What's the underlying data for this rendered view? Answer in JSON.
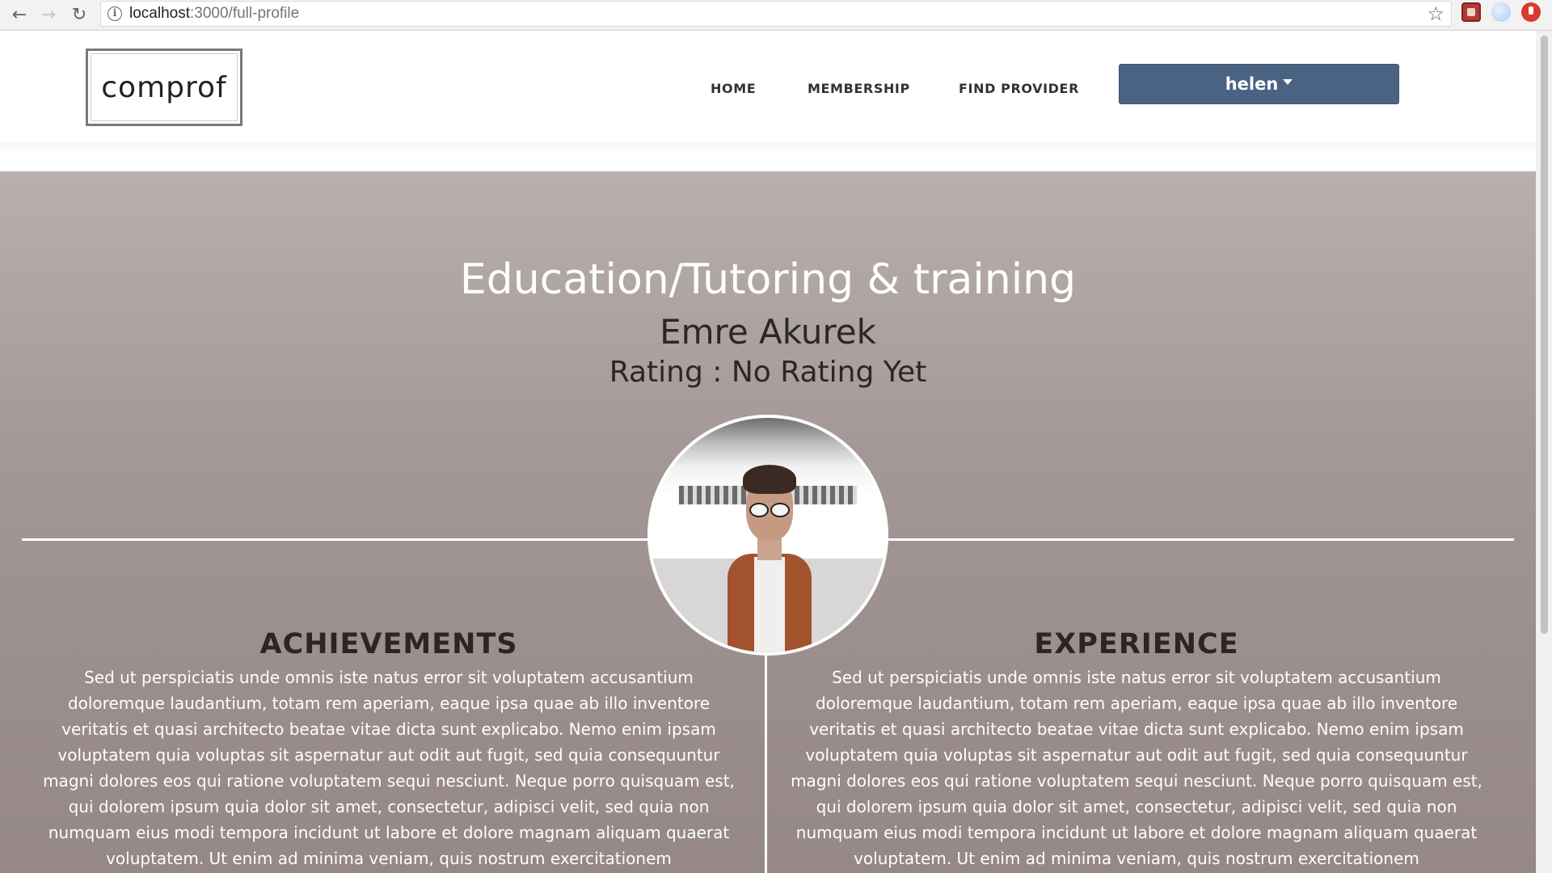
{
  "browser": {
    "url_host": "localhost",
    "url_path": ":3000/full-profile",
    "back_icon": "←",
    "forward_icon": "→",
    "reload_icon": "↻",
    "star_icon": "☆"
  },
  "header": {
    "logo": "comprof",
    "nav": {
      "home": "HOME",
      "membership": "MEMBERSHIP",
      "find_provider": "FIND PROVIDER"
    },
    "user_button": "helen",
    "accent_color": "#4b6383"
  },
  "profile": {
    "category": "Education/Tutoring & training",
    "name": "Emre Akurek",
    "rating": "Rating : No Rating Yet"
  },
  "sections": {
    "achievements": {
      "title": "ACHIEVEMENTS",
      "text": "Sed ut perspiciatis unde omnis iste natus error sit voluptatem accusantium doloremque laudantium, totam rem aperiam, eaque ipsa quae ab illo inventore veritatis et quasi architecto beatae vitae dicta sunt explicabo. Nemo enim ipsam voluptatem quia voluptas sit aspernatur aut odit aut fugit, sed quia consequuntur magni dolores eos qui ratione voluptatem sequi nesciunt. Neque porro quisquam est, qui dolorem ipsum quia dolor sit amet, consectetur, adipisci velit, sed quia non numquam eius modi tempora incidunt ut labore et dolore magnam aliquam quaerat voluptatem. Ut enim ad minima veniam, quis nostrum exercitationem"
    },
    "experience": {
      "title": "EXPERIENCE",
      "text": "Sed ut perspiciatis unde omnis iste natus error sit voluptatem accusantium doloremque laudantium, totam rem aperiam, eaque ipsa quae ab illo inventore veritatis et quasi architecto beatae vitae dicta sunt explicabo. Nemo enim ipsam voluptatem quia voluptas sit aspernatur aut odit aut fugit, sed quia consequuntur magni dolores eos qui ratione voluptatem sequi nesciunt. Neque porro quisquam est, qui dolorem ipsum quia dolor sit amet, consectetur, adipisci velit, sed quia non numquam eius modi tempora incidunt ut labore et dolore magnam aliquam quaerat voluptatem. Ut enim ad minima veniam, quis nostrum exercitationem"
    }
  }
}
